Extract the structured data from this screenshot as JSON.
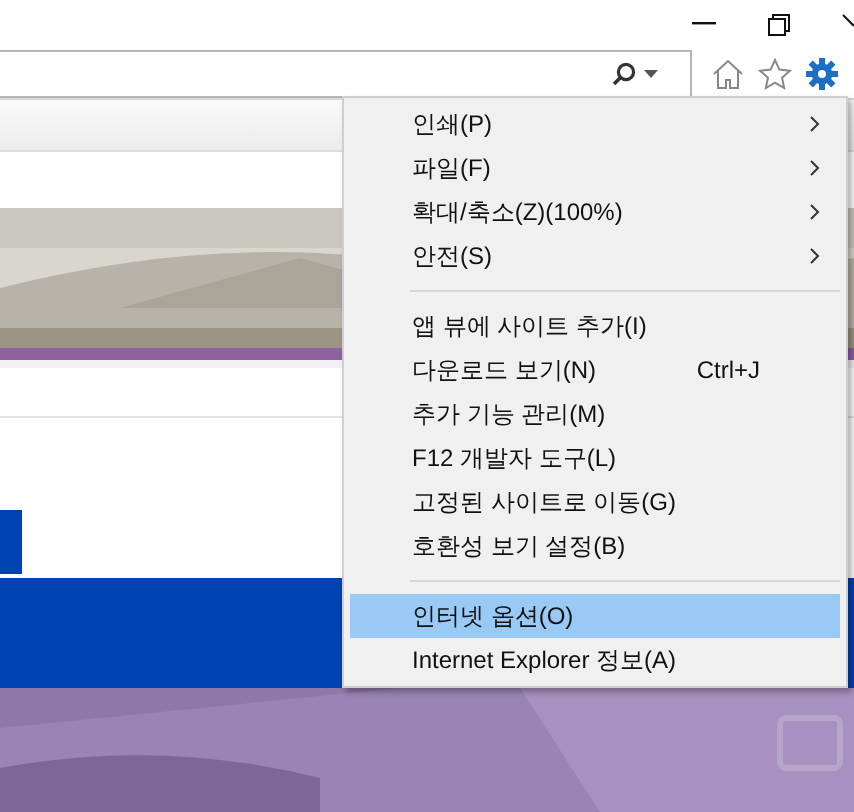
{
  "menu": {
    "groups": [
      [
        {
          "label": "인쇄(P)",
          "submenu": true,
          "selected": false
        },
        {
          "label": "파일(F)",
          "submenu": true,
          "selected": false
        },
        {
          "label": "확대/축소(Z)(100%)",
          "submenu": true,
          "selected": false
        },
        {
          "label": "안전(S)",
          "submenu": true,
          "selected": false
        }
      ],
      [
        {
          "label": "앱 뷰에 사이트 추가(I)",
          "selected": false
        },
        {
          "label": "다운로드 보기(N)",
          "shortcut": "Ctrl+J",
          "selected": false
        },
        {
          "label": "추가 기능 관리(M)",
          "selected": false
        },
        {
          "label": "F12 개발자 도구(L)",
          "selected": false
        },
        {
          "label": "고정된 사이트로 이동(G)",
          "selected": false
        },
        {
          "label": "호환성 보기 설정(B)",
          "selected": false
        }
      ],
      [
        {
          "label": "인터넷 옵션(O)",
          "selected": true
        },
        {
          "label": "Internet Explorer 정보(A)",
          "selected": false
        }
      ]
    ]
  }
}
